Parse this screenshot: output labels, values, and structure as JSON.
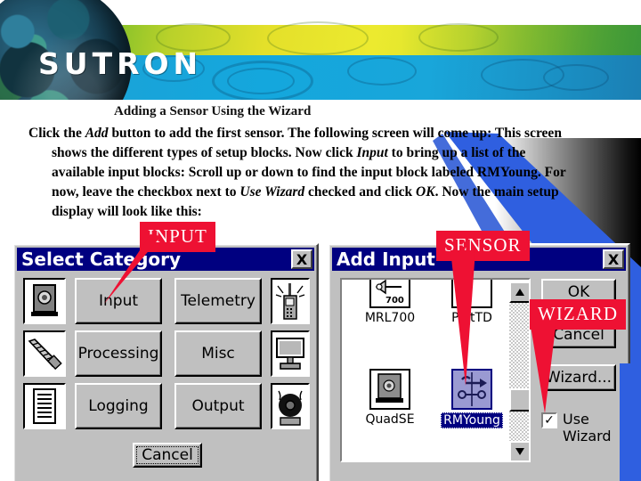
{
  "banner": {
    "logo_text": "SUTRON",
    "globe_name": "earth-globe-image"
  },
  "document": {
    "heading": "Adding a Sensor Using the Wizard",
    "paragraph_lines": [
      "Click the Add button to add the first sensor. The following screen will come up: This screen",
      "shows the different types of setup blocks. Now click Input to bring up a list of the",
      "available input blocks: Scroll up or down to find the input block labeled RMYoung. For",
      "now, leave the checkbox next to Use Wizard checked and click OK. Now the main setup",
      "display will look like this:"
    ],
    "paragraph_full": "Click the Add button to add the first sensor. The following screen will come up: This screen shows the different types of setup blocks. Now click Input to bring up a list of the available input blocks: Scroll up or down to find the input block labeled RMYoung. For now, leave the checkbox next to Use Wizard checked and click OK. Now the main setup display will look like this:",
    "italic_terms": [
      "Add",
      "Input",
      "Use Wizard",
      "OK"
    ]
  },
  "select_category_dialog": {
    "title": "Select Category",
    "close_label": "X",
    "buttons": [
      {
        "label": "Input",
        "icon": "sensor-dial-icon"
      },
      {
        "label": "Telemetry",
        "icon": "radio-antenna-icon"
      },
      {
        "label": "Processing",
        "icon": "screw-icon"
      },
      {
        "label": "Misc",
        "icon": "monitor-icon"
      },
      {
        "label": "Logging",
        "icon": "document-lines-icon"
      },
      {
        "label": "Output",
        "icon": "speaker-icon"
      }
    ],
    "cancel_label": "Cancel"
  },
  "add_input_dialog": {
    "title": "Add Input",
    "close_label": "X",
    "list_items": [
      {
        "label": "MRL700",
        "icon": "mrl700-icon",
        "selected": false
      },
      {
        "label": "PlatTD",
        "icon": "plattd-icon",
        "selected": false
      },
      {
        "label": "QuadSE",
        "icon": "quadse-icon",
        "selected": false
      },
      {
        "label": "RMYoung",
        "icon": "rmyoung-icon",
        "selected": true
      }
    ],
    "buttons": [
      {
        "label": "OK"
      },
      {
        "label": "Cancel"
      },
      {
        "label": "Wizard..."
      }
    ],
    "checkbox": {
      "label_line1": "Use",
      "label_line2": "Wizard",
      "checked": true,
      "check_glyph": "✓"
    },
    "scrollbar": {
      "up_glyph": "▲",
      "down_glyph": "▼"
    }
  },
  "callouts": [
    {
      "id": "input",
      "label": "INPUT",
      "color": "#ee1133"
    },
    {
      "id": "sensor",
      "label": "SENSOR",
      "color": "#ee1133"
    },
    {
      "id": "wizard",
      "label": "WIZARD",
      "color": "#ee1133"
    }
  ],
  "colors": {
    "callout_red": "#ee1133",
    "titlebar_blue": "#000080",
    "dialog_face": "#c0c0c0",
    "banner_blue": "#19a6da",
    "banner_green": "#e4e02a",
    "wedge_blue": "#2f5fe0"
  }
}
